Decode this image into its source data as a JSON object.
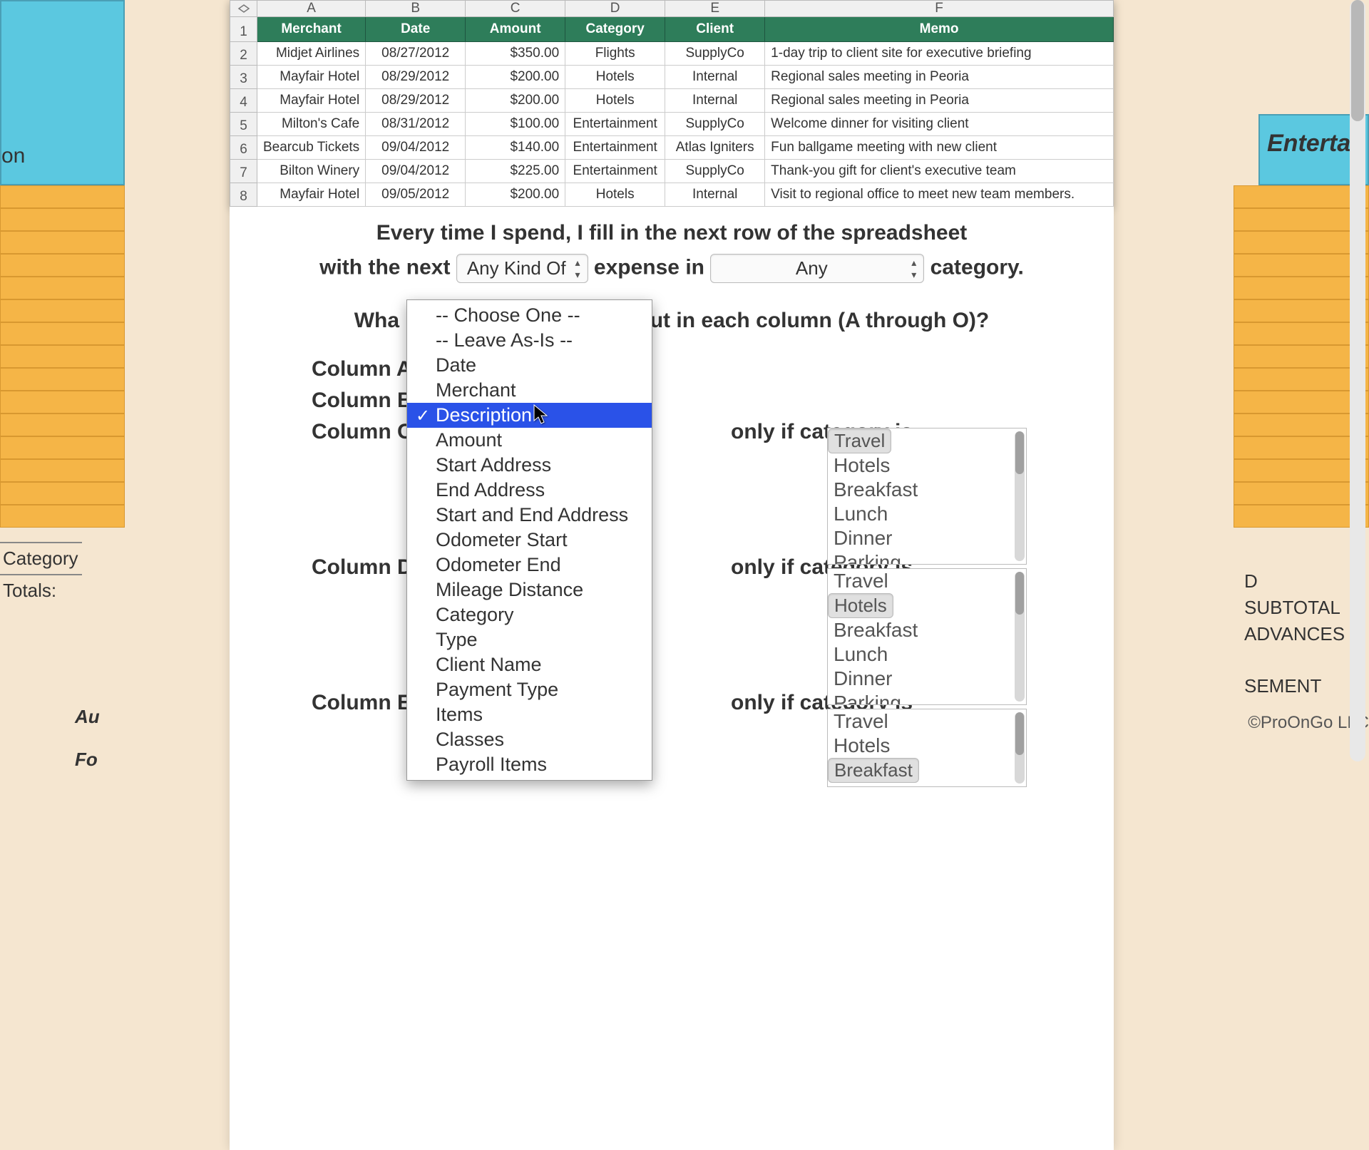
{
  "spreadsheet": {
    "columns": [
      "A",
      "B",
      "C",
      "D",
      "E",
      "F"
    ],
    "headers": [
      "Merchant",
      "Date",
      "Amount",
      "Category",
      "Client",
      "Memo"
    ],
    "rows": [
      {
        "n": "1"
      },
      {
        "n": "2",
        "c": [
          "Midjet Airlines",
          "08/27/2012",
          "$350.00",
          "Flights",
          "SupplyCo",
          "1-day trip to client site for executive briefing"
        ]
      },
      {
        "n": "3",
        "c": [
          "Mayfair Hotel",
          "08/29/2012",
          "$200.00",
          "Hotels",
          "Internal",
          "Regional sales meeting in Peoria"
        ]
      },
      {
        "n": "4",
        "c": [
          "Mayfair Hotel",
          "08/29/2012",
          "$200.00",
          "Hotels",
          "Internal",
          "Regional sales meeting in Peoria"
        ]
      },
      {
        "n": "5",
        "c": [
          "Milton's Cafe",
          "08/31/2012",
          "$100.00",
          "Entertainment",
          "SupplyCo",
          "Welcome dinner for visiting client"
        ]
      },
      {
        "n": "6",
        "c": [
          "Bearcub Tickets",
          "09/04/2012",
          "$140.00",
          "Entertainment",
          "Atlas Igniters",
          "Fun ballgame meeting with new client"
        ]
      },
      {
        "n": "7",
        "c": [
          "Bilton Winery",
          "09/04/2012",
          "$225.00",
          "Entertainment",
          "SupplyCo",
          "Thank-you gift for client's executive team"
        ]
      },
      {
        "n": "8",
        "c": [
          "Mayfair Hotel",
          "09/05/2012",
          "$200.00",
          "Hotels",
          "Internal",
          "Visit to regional office to meet new team members."
        ]
      }
    ]
  },
  "instructions": {
    "line1": "Every time I spend, I fill in the next row of the spreadsheet",
    "line2_prefix": "with the next",
    "sel_kind": "Any Kind Of",
    "line2_mid": "expense in",
    "sel_cat": "Any",
    "line2_suffix": "category.",
    "question_prefix": "Wha",
    "question_suffix": "ut in each column (A through O)?",
    "columns": {
      "a": "Column A:",
      "b": "Column B:",
      "c": "Column C:",
      "d": "Column D:",
      "e": "Column E:"
    },
    "only_text": "only if category is"
  },
  "dropdown": {
    "items": [
      "-- Choose One --",
      "-- Leave As-Is --",
      "Date",
      "Merchant",
      "Description",
      "Amount",
      "Start Address",
      "End Address",
      "Start and End Address",
      "Odometer Start",
      "Odometer End",
      "Mileage Distance",
      "Category",
      "Type",
      "Client Name",
      "Payment Type",
      "Items",
      "Classes",
      "Payroll Items"
    ],
    "highlighted": "Description"
  },
  "listbox": {
    "items": [
      "Travel",
      "Hotels",
      "Breakfast",
      "Lunch",
      "Dinner",
      "Parking"
    ],
    "selected": {
      "c": [
        "Travel"
      ],
      "d": [
        "Hotels"
      ],
      "e": [
        "Breakfast"
      ]
    }
  },
  "background": {
    "teal_left": "on",
    "teal_right": "Entertai",
    "left_labels": {
      "l1": "Category",
      "l2": "Totals:"
    },
    "au": "Au",
    "fo": "Fo",
    "right_labels": {
      "l1": "D",
      "l2": "SUBTOTAL",
      "l3": "ADVANCES",
      "l4": "SEMENT"
    },
    "copyright": "©ProOnGo LLC"
  }
}
